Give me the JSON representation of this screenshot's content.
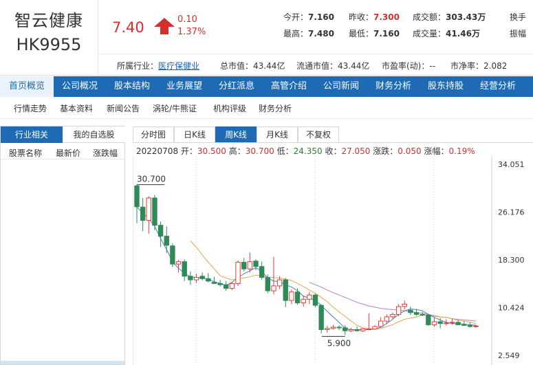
{
  "header": {
    "stock_name": "智云健康",
    "stock_code": "HK9955",
    "price": "7.40",
    "change": "0.10",
    "change_pct": "1.37%",
    "quotes": [
      {
        "label": "今开：",
        "value": "7.160",
        "red": false
      },
      {
        "label": "昨收：",
        "value": "7.300",
        "red": true
      },
      {
        "label": "成交额：",
        "value": "303.43万",
        "red": false
      },
      {
        "label": "换手",
        "value": "",
        "red": false
      },
      {
        "label": "最高：",
        "value": "7.480",
        "red": false
      },
      {
        "label": "最低：",
        "value": "7.160",
        "red": false
      },
      {
        "label": "成交量：",
        "value": "41.46万",
        "red": false
      },
      {
        "label": "振幅",
        "value": "",
        "red": false
      }
    ],
    "info": {
      "industry_label": "所属行业：",
      "industry": "医疗保健业",
      "market_cap": "总市值：43.44亿",
      "float_cap": "流通市值：43.44亿",
      "pe": "市盈率(动)：--",
      "pb": "市净率：2.082"
    }
  },
  "main_nav": [
    "首页概览",
    "公司概况",
    "股本结构",
    "业务展望",
    "分红派息",
    "高管介绍",
    "公司新闻",
    "财务分析",
    "股东持股",
    "经营分析"
  ],
  "sub_nav": [
    "行情走势",
    "基本资料",
    "新闻公告",
    "涡轮/牛熊证",
    "机构评级",
    "财务分析"
  ],
  "left_panel": {
    "tabs": [
      "行业相关",
      "我的自选股"
    ],
    "headers": [
      "股票名称",
      "最新价",
      "涨跌幅"
    ]
  },
  "chart_tabs": [
    "分时图",
    "日K线",
    "周K线",
    "月K线",
    "不复权"
  ],
  "ohlc": {
    "date": "20220708",
    "open_label": "开：",
    "open": "30.500",
    "high_label": "高：",
    "high": "30.700",
    "low_label": "低：",
    "low": "24.350",
    "close_label": "收：",
    "close": "27.050",
    "chg_label": "涨跌：",
    "chg": "0.050",
    "pct_label": "涨幅：",
    "pct": "0.19%"
  },
  "colors": {
    "up": "#e53935",
    "down": "#2e8b57",
    "ma5": "#3f7fc0",
    "ma10": "#e8a54a",
    "ma20": "#b57fc7",
    "nav": "#1e6ab4"
  },
  "chart_data": {
    "type": "candlestick",
    "y_ticks": [
      34.051,
      26.176,
      18.3,
      10.424,
      2.549
    ],
    "y_tick_labels": [
      "34.051",
      "26.176",
      "18.300",
      "10.424",
      "2.549"
    ],
    "ylim": [
      2.549,
      34.051
    ],
    "high_annotation": "30.700",
    "low_annotation": "5.900",
    "candles": [
      [
        30.5,
        30.7,
        24.35,
        27.05
      ],
      [
        27.0,
        28.5,
        23.0,
        24.8
      ],
      [
        24.8,
        28.8,
        22.6,
        28.5
      ],
      [
        28.5,
        29.0,
        23.2,
        24.0
      ],
      [
        24.0,
        24.6,
        20.4,
        22.2
      ],
      [
        22.2,
        23.8,
        19.4,
        20.7
      ],
      [
        20.6,
        21.0,
        17.1,
        17.6
      ],
      [
        17.6,
        18.3,
        16.2,
        18.0
      ],
      [
        18.0,
        18.4,
        14.8,
        15.6
      ],
      [
        15.6,
        16.4,
        14.2,
        15.0
      ],
      [
        15.0,
        16.0,
        14.5,
        15.4
      ],
      [
        15.6,
        16.2,
        14.9,
        15.2
      ],
      [
        15.2,
        16.1,
        14.6,
        14.8
      ],
      [
        14.6,
        15.5,
        14.3,
        14.4
      ],
      [
        14.4,
        15.0,
        13.9,
        14.2
      ],
      [
        14.2,
        14.8,
        13.2,
        13.6
      ],
      [
        13.6,
        14.6,
        13.3,
        14.4
      ],
      [
        14.4,
        18.2,
        14.0,
        17.9
      ],
      [
        17.9,
        18.6,
        16.4,
        16.8
      ],
      [
        16.8,
        19.5,
        16.2,
        18.0
      ],
      [
        18.1,
        18.4,
        16.6,
        17.2
      ],
      [
        17.2,
        18.0,
        15.0,
        15.4
      ],
      [
        15.4,
        15.9,
        12.8,
        13.2
      ],
      [
        13.2,
        18.8,
        12.6,
        14.0
      ],
      [
        14.0,
        15.6,
        13.5,
        15.0
      ],
      [
        15.0,
        15.3,
        10.5,
        11.6
      ],
      [
        11.6,
        13.4,
        11.0,
        13.0
      ],
      [
        13.0,
        13.6,
        10.9,
        11.2
      ],
      [
        11.2,
        12.4,
        10.6,
        11.8
      ],
      [
        11.8,
        13.0,
        11.0,
        12.5
      ],
      [
        12.5,
        12.7,
        10.5,
        10.8
      ],
      [
        10.8,
        11.0,
        6.2,
        6.8
      ],
      [
        6.8,
        7.4,
        6.3,
        7.0
      ],
      [
        7.0,
        7.6,
        6.8,
        7.2
      ],
      [
        7.2,
        7.5,
        6.7,
        7.1
      ],
      [
        7.1,
        7.5,
        5.9,
        6.6
      ],
      [
        6.6,
        7.1,
        6.4,
        6.8
      ],
      [
        6.8,
        7.3,
        6.5,
        6.6
      ],
      [
        6.6,
        7.0,
        6.4,
        6.9
      ],
      [
        6.9,
        9.5,
        6.7,
        6.9
      ],
      [
        6.9,
        7.5,
        6.8,
        7.3
      ],
      [
        7.3,
        8.8,
        7.1,
        8.2
      ],
      [
        8.2,
        9.3,
        7.8,
        8.9
      ],
      [
        8.9,
        9.6,
        8.6,
        9.3
      ],
      [
        9.3,
        11.0,
        9.0,
        10.6
      ],
      [
        10.6,
        11.6,
        10.1,
        11.0
      ],
      [
        10.0,
        10.6,
        9.2,
        9.6
      ],
      [
        9.6,
        10.2,
        9.1,
        9.3
      ],
      [
        9.3,
        9.7,
        9.0,
        9.2
      ],
      [
        9.2,
        9.4,
        7.4,
        7.6
      ],
      [
        7.6,
        8.7,
        7.3,
        8.1
      ],
      [
        8.1,
        8.7,
        7.0,
        7.8
      ],
      [
        7.8,
        8.5,
        7.5,
        7.9
      ],
      [
        7.9,
        8.6,
        7.6,
        8.0
      ],
      [
        8.0,
        8.4,
        7.5,
        7.6
      ],
      [
        7.6,
        8.2,
        7.4,
        7.5
      ],
      [
        7.5,
        8.0,
        7.1,
        7.3
      ],
      [
        7.3,
        7.6,
        7.1,
        7.4
      ]
    ],
    "ma5": [
      27.0,
      26.0,
      25.1,
      23.8,
      21.8,
      20.0,
      18.0,
      16.9,
      16.1,
      15.5,
      15.4,
      15.3,
      15.1,
      14.7,
      14.4,
      14.1,
      14.6,
      15.4,
      16.0,
      16.5,
      17.0,
      16.4,
      15.3,
      14.8,
      14.7,
      14.2,
      13.8,
      13.2,
      12.3,
      12.0,
      11.6,
      10.8,
      9.8,
      8.9,
      8.0,
      7.0,
      6.8,
      6.8,
      6.8,
      6.8,
      6.9,
      7.2,
      7.8,
      8.5,
      9.3,
      9.9,
      10.2,
      10.1,
      9.9,
      9.3,
      8.8,
      8.4,
      8.0,
      7.8,
      7.8,
      7.7,
      7.6,
      7.5
    ],
    "ma10": [
      null,
      null,
      null,
      null,
      null,
      null,
      null,
      null,
      null,
      21.4,
      20.4,
      19.1,
      17.9,
      16.8,
      15.7,
      15.3,
      15.0,
      15.2,
      15.3,
      15.5,
      15.8,
      15.6,
      15.4,
      15.4,
      15.3,
      15.1,
      14.9,
      14.4,
      13.9,
      13.3,
      12.8,
      12.1,
      11.4,
      10.5,
      9.7,
      9.0,
      8.2,
      7.5,
      7.1,
      6.9,
      6.9,
      7.0,
      7.3,
      7.6,
      8.1,
      8.5,
      8.7,
      8.9,
      9.2,
      9.1,
      9.0,
      8.9,
      8.8,
      8.6,
      8.3,
      8.2,
      8.0,
      7.8
    ],
    "ma20": [
      null,
      null,
      null,
      null,
      null,
      null,
      null,
      null,
      null,
      null,
      null,
      null,
      null,
      null,
      null,
      null,
      null,
      null,
      null,
      null,
      null,
      null,
      null,
      null,
      null,
      null,
      null,
      null,
      null,
      14.6,
      14.2,
      13.8,
      13.3,
      12.9,
      12.5,
      12.1,
      11.7,
      11.3,
      11.0,
      10.7,
      10.5,
      10.3,
      10.2,
      10.1,
      10.0,
      9.9,
      9.8,
      9.6,
      9.5,
      9.3,
      9.1,
      8.9,
      8.8,
      8.6,
      8.5,
      8.4,
      8.3,
      8.2
    ]
  }
}
